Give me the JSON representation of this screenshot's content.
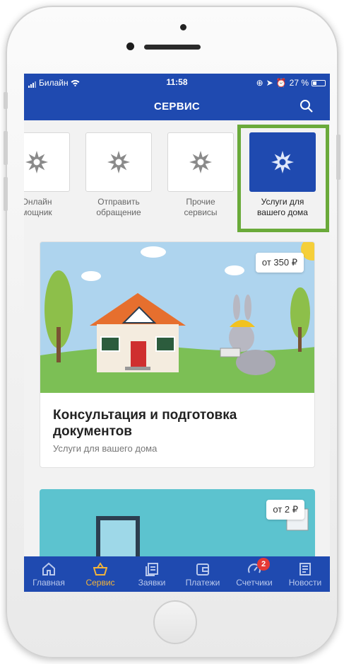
{
  "status": {
    "carrier": "Билайн",
    "time": "11:58",
    "battery": "27 %"
  },
  "header": {
    "title": "СЕРВИС"
  },
  "tiles": [
    {
      "label_line1": "Онлайн",
      "label_line2": "мощник",
      "selected": false
    },
    {
      "label_line1": "Отправить",
      "label_line2": "обращение",
      "selected": false
    },
    {
      "label_line1": "Прочие",
      "label_line2": "сервисы",
      "selected": false
    },
    {
      "label_line1": "Услуги для",
      "label_line2": "вашего дома",
      "selected": true
    }
  ],
  "card1": {
    "price": "от 350 ₽",
    "title": "Консультация и подготовка документов",
    "subtitle": "Услуги для вашего дома"
  },
  "card2": {
    "price": "от 2 ₽"
  },
  "tabbar": {
    "items": [
      {
        "label": "Главная",
        "icon": "home-icon"
      },
      {
        "label": "Сервис",
        "icon": "basket-icon",
        "active": true
      },
      {
        "label": "Заявки",
        "icon": "requests-icon"
      },
      {
        "label": "Платежи",
        "icon": "wallet-icon"
      },
      {
        "label": "Счетчики",
        "icon": "meter-icon",
        "badge": "2"
      },
      {
        "label": "Новости",
        "icon": "news-icon"
      }
    ]
  },
  "colors": {
    "brand": "#1f4ab0",
    "active_tab": "#f3b43a",
    "highlight": "#6aaa3a",
    "badge": "#e53935"
  }
}
